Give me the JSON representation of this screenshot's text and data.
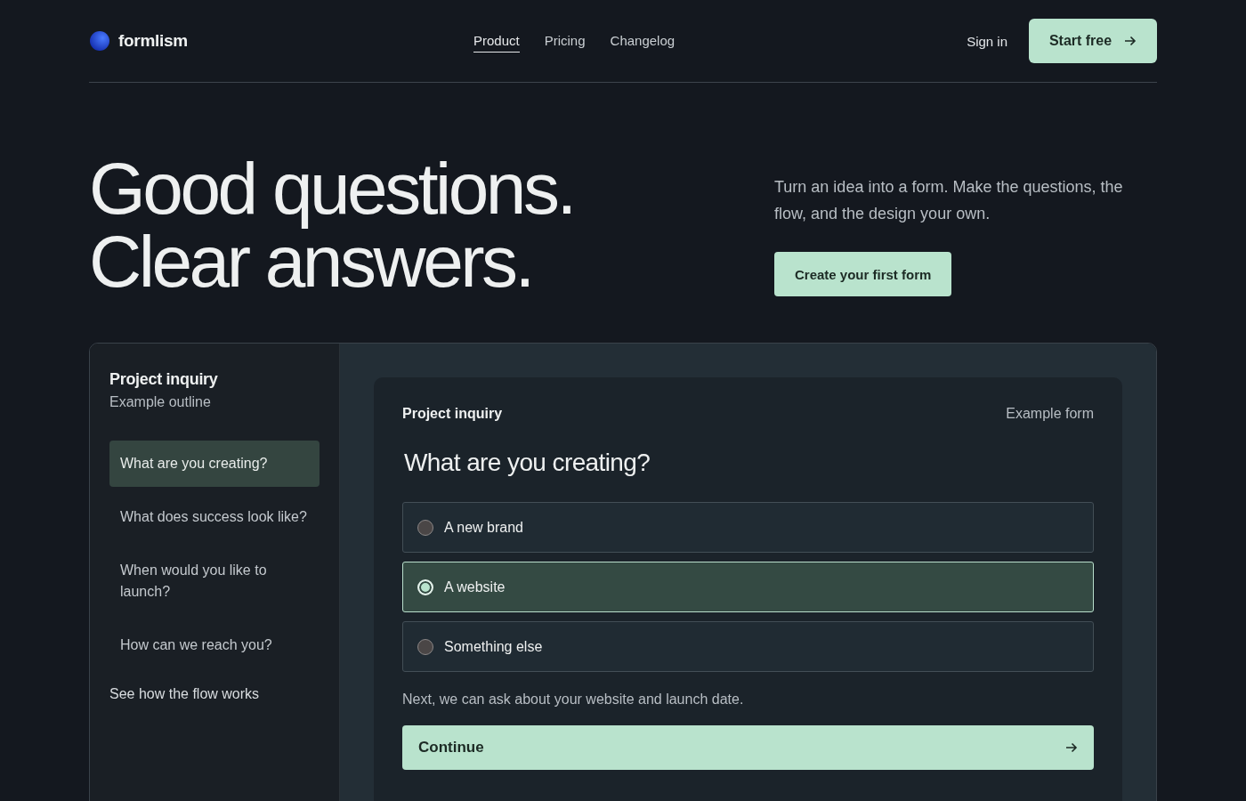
{
  "brand": {
    "name": "formlism"
  },
  "nav": [
    {
      "label": "Product",
      "selected": true
    },
    {
      "label": "Pricing",
      "selected": false
    },
    {
      "label": "Changelog",
      "selected": false
    }
  ],
  "sign_in": "Sign in",
  "start_button": "Start free",
  "hero": {
    "title_lines": [
      "Good questions.",
      "Clear answers."
    ],
    "description": "Turn an idea into a form. Make the questions, the flow, and the design your own.",
    "cta": "Create your first form"
  },
  "outline": {
    "title": "Project inquiry",
    "subtitle": "Example outline",
    "items": [
      {
        "label": "What are you creating?",
        "selected": true
      },
      {
        "label": "What does success look like?",
        "selected": false
      },
      {
        "label": "When would you like to launch?",
        "selected": false
      },
      {
        "label": "How can we reach you?",
        "selected": false
      }
    ],
    "link": "See how the flow works"
  },
  "form": {
    "title": "Project inquiry",
    "tag": "Example form",
    "question": "What are you creating?",
    "options": [
      {
        "label": "A new brand",
        "selected": false
      },
      {
        "label": "A website",
        "selected": true
      },
      {
        "label": "Something else",
        "selected": false
      }
    ],
    "hint": "Next, we can ask about your website and launch date.",
    "button": "Continue"
  }
}
